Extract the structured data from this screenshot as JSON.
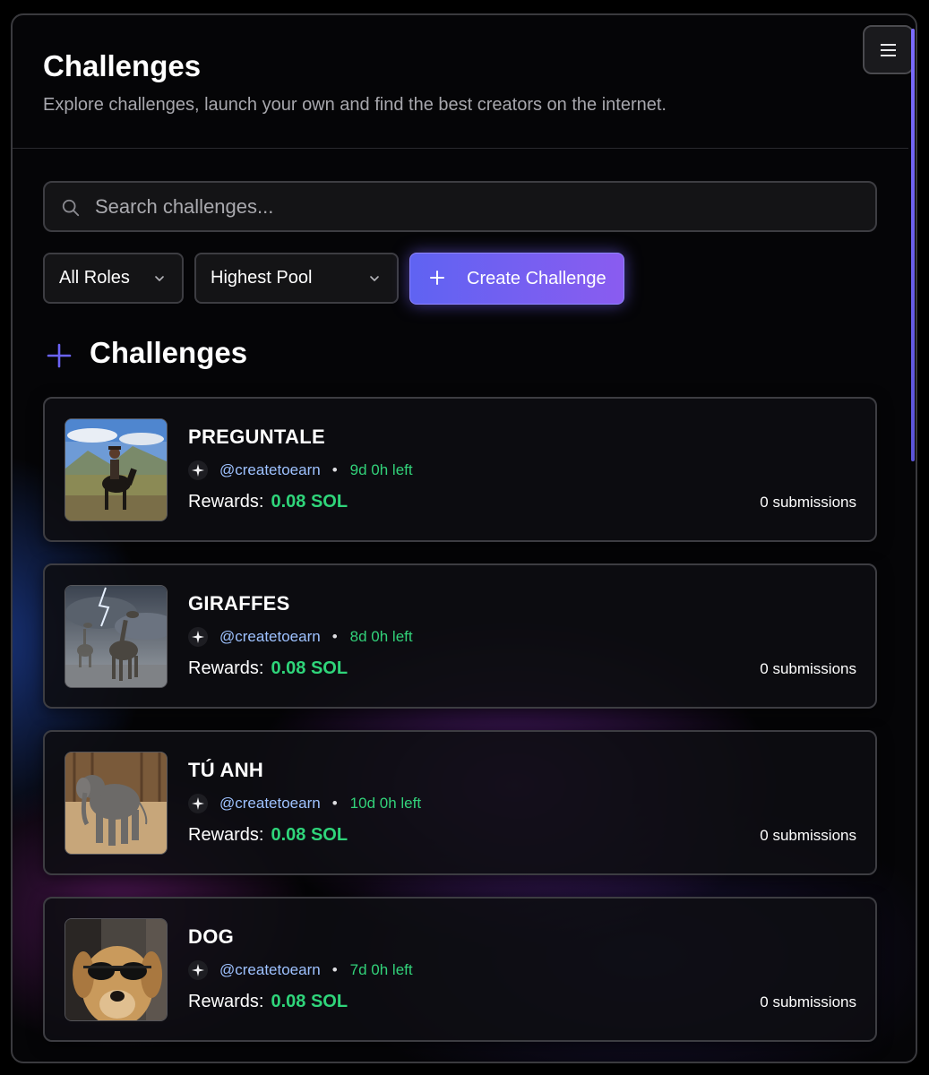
{
  "header": {
    "title": "Challenges",
    "subtitle": "Explore challenges, launch your own and find the best creators on the internet."
  },
  "search": {
    "placeholder": "Search challenges..."
  },
  "filters": {
    "roles": "All Roles",
    "sort": "Highest Pool",
    "create_label": "Create Challenge"
  },
  "section": {
    "title": "Challenges"
  },
  "colors": {
    "accent": "#6b63f5",
    "reward": "#2fd57a",
    "handle": "#9ec2ff"
  },
  "challenges": [
    {
      "title": "PREGUNTALE",
      "handle": "@createtoearn",
      "time_left": "9d 0h left",
      "rewards_label": "Rewards:",
      "reward": "0.08 SOL",
      "submissions": "0 submissions",
      "image": "rider-on-horse"
    },
    {
      "title": "GIRAFFES",
      "handle": "@createtoearn",
      "time_left": "8d 0h left",
      "rewards_label": "Rewards:",
      "reward": "0.08 SOL",
      "submissions": "0 submissions",
      "image": "giraffes-storm"
    },
    {
      "title": "TÚ ANH",
      "handle": "@createtoearn",
      "time_left": "10d 0h left",
      "rewards_label": "Rewards:",
      "reward": "0.08 SOL",
      "submissions": "0 submissions",
      "image": "baby-elephant"
    },
    {
      "title": "DOG",
      "handle": "@createtoearn",
      "time_left": "7d 0h left",
      "rewards_label": "Rewards:",
      "reward": "0.08 SOL",
      "submissions": "0 submissions",
      "image": "dog-sunglasses"
    }
  ]
}
